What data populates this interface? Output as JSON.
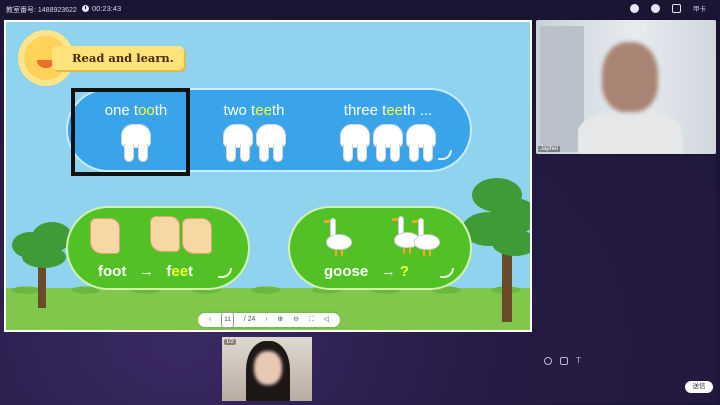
{
  "topbar": {
    "room_label": "教室番号: 1488923622",
    "timer": "00:23:43",
    "right_label": "甲卡"
  },
  "slide": {
    "title": "Read and learn.",
    "teeth_groups": [
      {
        "pre": "one t",
        "hl": "oo",
        "post": "th",
        "count": 1
      },
      {
        "pre": "two t",
        "hl": "ee",
        "post": "th",
        "count": 2
      },
      {
        "pre": "three t",
        "hl": "ee",
        "post": "th ...",
        "count": 3
      }
    ],
    "foot_pill": {
      "word1": "foot",
      "arrow": "→",
      "pre": "f",
      "hl": "ee",
      "post": "t"
    },
    "goose_pill": {
      "word1": "goose",
      "arrow": "→",
      "question": "?"
    }
  },
  "slide_toolbar": {
    "prev": "‹",
    "page": "11",
    "total": "/ 24",
    "next": "›",
    "zoom_in": "⊕",
    "zoom_out": "⊖",
    "fullscreen": "⛶",
    "collapse": "◁"
  },
  "teacher": {
    "name": "Japhet"
  },
  "student": {
    "tag": "1/2"
  },
  "chat": {
    "send_label": "送信"
  }
}
